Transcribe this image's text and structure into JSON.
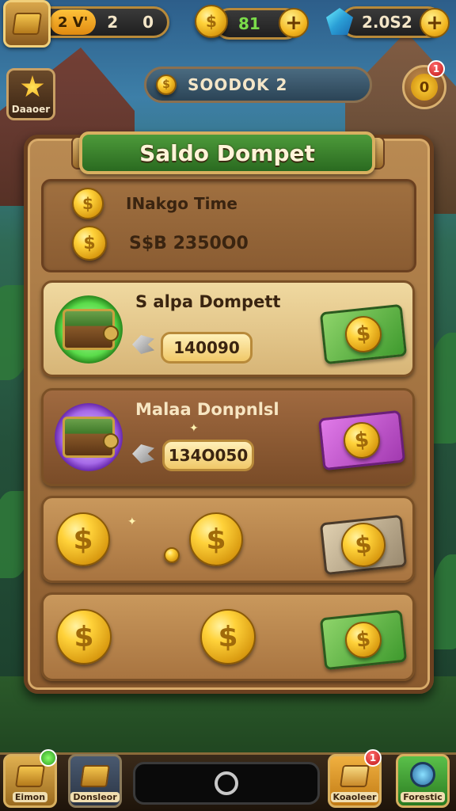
{
  "top_bar": {
    "level_left": "2 V'",
    "level_right": "2 0",
    "coins": "81",
    "gems": "2.0S2",
    "plus": "+"
  },
  "second_row": {
    "star_label": "Daaoer",
    "currency_display": "SOODOK 2",
    "notification_value": "0",
    "notification_badge": "1"
  },
  "panel": {
    "title": "Saldo Dompet",
    "info": {
      "time_label": "INakgo Time",
      "balance": "S$B 2350O0"
    },
    "cards": [
      {
        "title": "S alpa Dompett",
        "value": "140090"
      },
      {
        "title": "Malaa Donpnlsl",
        "value": "134O050"
      }
    ]
  },
  "bottom_nav": {
    "left_label": "Eimon",
    "second_label": "Donsleor",
    "right_badge": "1",
    "fourth_label": "Koaoleer",
    "fifth_label": "Forestic"
  },
  "colors": {
    "panel_wood": "#b98a52",
    "title_green": "#4d9a3a",
    "coin_gold": "#ffd23a",
    "badge_red": "#c01818"
  }
}
